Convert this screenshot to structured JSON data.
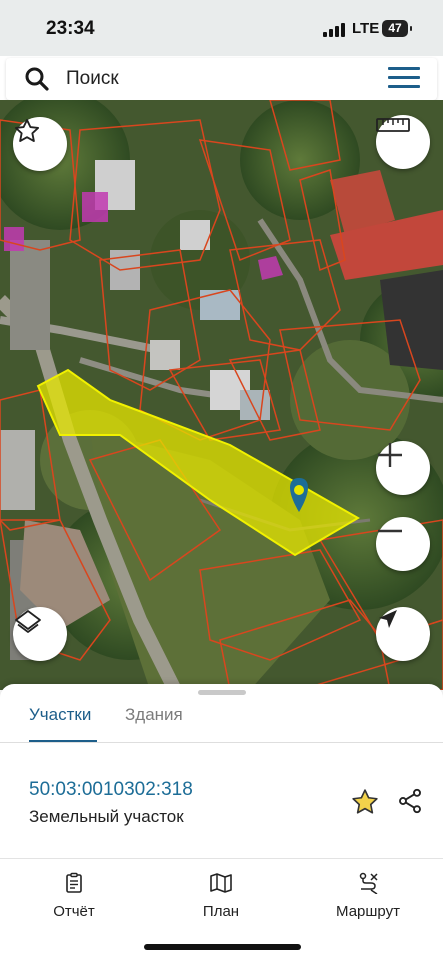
{
  "status_bar": {
    "time": "23:34",
    "network": "LTE",
    "battery": "47"
  },
  "search": {
    "label": "Поиск"
  },
  "map": {
    "icons": [
      "star-icon",
      "ruler-icon",
      "zoom-in-icon",
      "zoom-out-icon",
      "layers-icon",
      "locate-icon",
      "location-pin-icon"
    ],
    "colors": {
      "highlight_parcel": "#e6e600",
      "parcel_border": "#d9461e",
      "pin": "#1d6d97"
    }
  },
  "sheet": {
    "tabs": [
      {
        "label": "Участки",
        "active": true
      },
      {
        "label": "Здания",
        "active": false
      }
    ],
    "parcel": {
      "id": "50:03:0010302:318",
      "type": "Земельный участок"
    }
  },
  "bottom_nav": [
    {
      "label": "Отчёт",
      "icon": "report-icon"
    },
    {
      "label": "План",
      "icon": "map-plan-icon"
    },
    {
      "label": "Маршрут",
      "icon": "route-icon"
    }
  ],
  "accent": "#1d5e8a"
}
